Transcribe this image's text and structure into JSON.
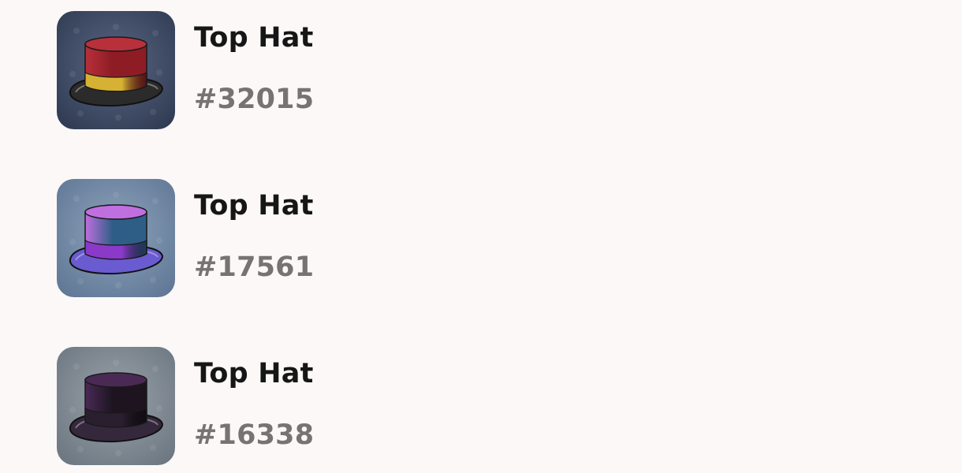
{
  "items": [
    {
      "title": "Top Hat",
      "code": "#32015",
      "icon": "top-hat-red-icon",
      "colors": {
        "bg1": "#5a6783",
        "bg2": "#2f3a52",
        "crown": "#8e1c25",
        "crownLight": "#b8303a",
        "band": "#d6b133",
        "brim": "#2b2b2b"
      }
    },
    {
      "title": "Top Hat",
      "code": "#17561",
      "icon": "top-hat-blue-violet-icon",
      "colors": {
        "bg1": "#8ea3bc",
        "bg2": "#5f7795",
        "crown": "#2e5e86",
        "crownLight": "#c06fe0",
        "band": "#8b39c9",
        "brim": "#6a5bd0"
      }
    },
    {
      "title": "Top Hat",
      "code": "#16338",
      "icon": "top-hat-black-purple-icon",
      "colors": {
        "bg1": "#9aa3ab",
        "bg2": "#6c7680",
        "crown": "#1d1420",
        "crownLight": "#4a2a55",
        "band": "#2a1f2e",
        "brim": "#35283c"
      }
    }
  ]
}
